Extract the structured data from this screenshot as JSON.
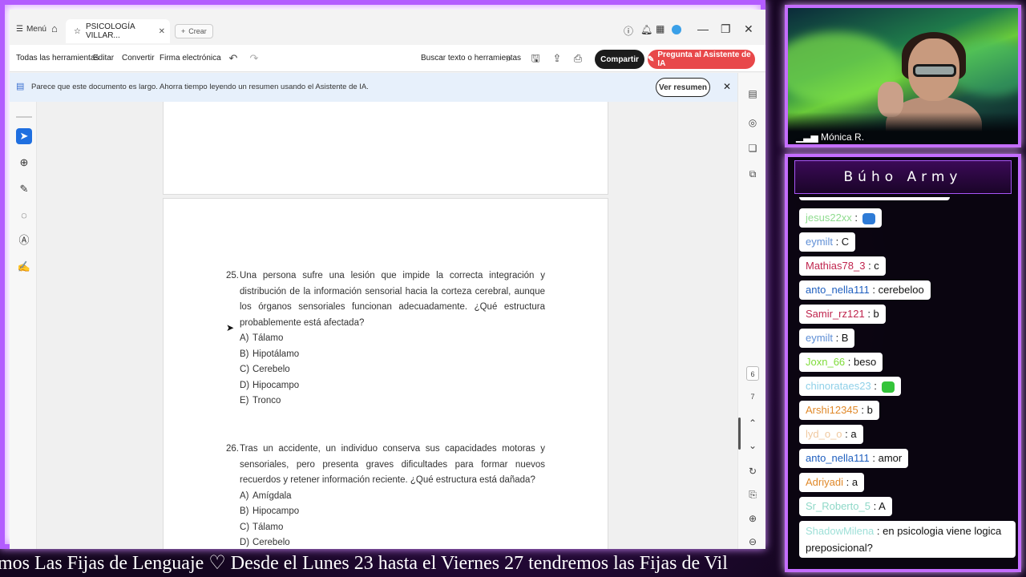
{
  "browser": {
    "menu_label": "Menú",
    "tab_title": "PSICOLOGÍA VILLAR...",
    "new_tab_label": "Crear",
    "toolbar": {
      "all_tools": "Todas las herramientas",
      "edit": "Editar",
      "convert": "Convertir",
      "esign": "Firma electrónica",
      "search_placeholder": "Buscar texto o herramientas",
      "share": "Compartir",
      "ask_ai": "Pregunta al Asistente de IA"
    },
    "banner": {
      "text": "Parece que este documento es largo. Ahorra tiempo leyendo un resumen usando el Asistente de IA.",
      "view_summary": "Ver resumen"
    },
    "page_numbers": [
      "6",
      "7"
    ]
  },
  "document": {
    "questions": [
      {
        "number": "25.",
        "stem": "Una persona sufre una lesión que impide la correcta integración y distribución de la información sensorial hacia la corteza cerebral, aunque los órganos sensoriales funcionan adecuadamente. ¿Qué estructura probablemente está afectada?",
        "options": [
          {
            "letter": "A)",
            "text": "Tálamo"
          },
          {
            "letter": "B)",
            "text": "Hipotálamo"
          },
          {
            "letter": "C)",
            "text": "Cerebelo"
          },
          {
            "letter": "D)",
            "text": "Hipocampo"
          },
          {
            "letter": "E)",
            "text": "Tronco"
          }
        ]
      },
      {
        "number": "26.",
        "stem": "Tras un accidente, un individuo conserva sus capacidades motoras y sensoriales, pero presenta graves dificultades para formar nuevos recuerdos y retener información reciente. ¿Qué estructura está dañada?",
        "options": [
          {
            "letter": "A)",
            "text": "Amígdala"
          },
          {
            "letter": "B)",
            "text": "Hipocampo"
          },
          {
            "letter": "C)",
            "text": "Tálamo"
          },
          {
            "letter": "D)",
            "text": "Cerebelo"
          }
        ]
      }
    ]
  },
  "ticker": {
    "text": "mos Las Fijas de Lenguaje   ♡   Desde el Lunes 23 hasta el Viernes 27 tendremos las Fijas de Vil"
  },
  "webcam": {
    "name": "Mónica R."
  },
  "chat": {
    "title": "Búho Army",
    "messages": [
      {
        "user": "jesus22xx",
        "text": "",
        "color": "#8fdc8f",
        "emote": "#2e7bd6"
      },
      {
        "user": "eymilt",
        "text": "C",
        "color": "#5f8fd6"
      },
      {
        "user": "Mathias78_3",
        "text": "c",
        "color": "#c0254e"
      },
      {
        "user": "anto_nella111",
        "text": "cerebeloo",
        "color": "#1f5fbf"
      },
      {
        "user": "Samir_rz121",
        "text": "b",
        "color": "#c0254e"
      },
      {
        "user": "eymilt",
        "text": "B",
        "color": "#5f8fd6"
      },
      {
        "user": "Joxn_66",
        "text": "beso",
        "color": "#7fdc3a"
      },
      {
        "user": "chinorataes23",
        "text": "",
        "color": "#8fd0e8",
        "emote": "#34c43a"
      },
      {
        "user": "Arshi12345",
        "text": "b",
        "color": "#e0892a"
      },
      {
        "user": "lyd_o_o",
        "text": "a",
        "color": "#f0c9a0"
      },
      {
        "user": "anto_nella111",
        "text": "amor",
        "color": "#1f5fbf"
      },
      {
        "user": "Adriyadi",
        "text": "a",
        "color": "#e0892a"
      },
      {
        "user": "Sr_Roberto_5",
        "text": "A",
        "color": "#8fd8c8"
      },
      {
        "user": "ShadowMilena",
        "text": "en psicologia viene logica preposicional?",
        "color": "#9fe0d8"
      }
    ]
  }
}
